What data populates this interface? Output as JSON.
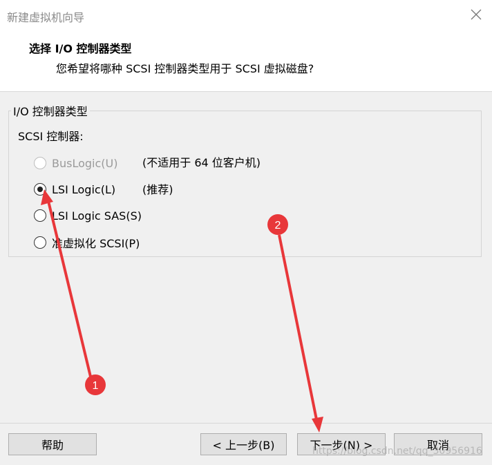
{
  "window": {
    "title": "新建虚拟机向导"
  },
  "header": {
    "title": "选择 I/O 控制器类型",
    "subtitle": "您希望将哪种 SCSI 控制器类型用于 SCSI 虚拟磁盘?"
  },
  "group": {
    "legend": "I/O 控制器类型",
    "scsi_label": "SCSI 控制器:",
    "options": [
      {
        "label": "BusLogic(U)",
        "note": "(不适用于 64 位客户机)",
        "checked": false,
        "disabled": true
      },
      {
        "label": "LSI Logic(L)",
        "note": "(推荐)",
        "checked": true,
        "disabled": false
      },
      {
        "label": "LSI Logic SAS(S)",
        "note": "",
        "checked": false,
        "disabled": false
      },
      {
        "label": "准虚拟化 SCSI(P)",
        "note": "",
        "checked": false,
        "disabled": false
      }
    ]
  },
  "buttons": {
    "help": "帮助",
    "back": "< 上一步(B)",
    "next": "下一步(N) >",
    "cancel": "取消"
  },
  "annotations": {
    "badge1": "1",
    "badge2": "2",
    "color": "#e8373a"
  },
  "watermark": "https://blog.csdn.net/qq_30956916"
}
